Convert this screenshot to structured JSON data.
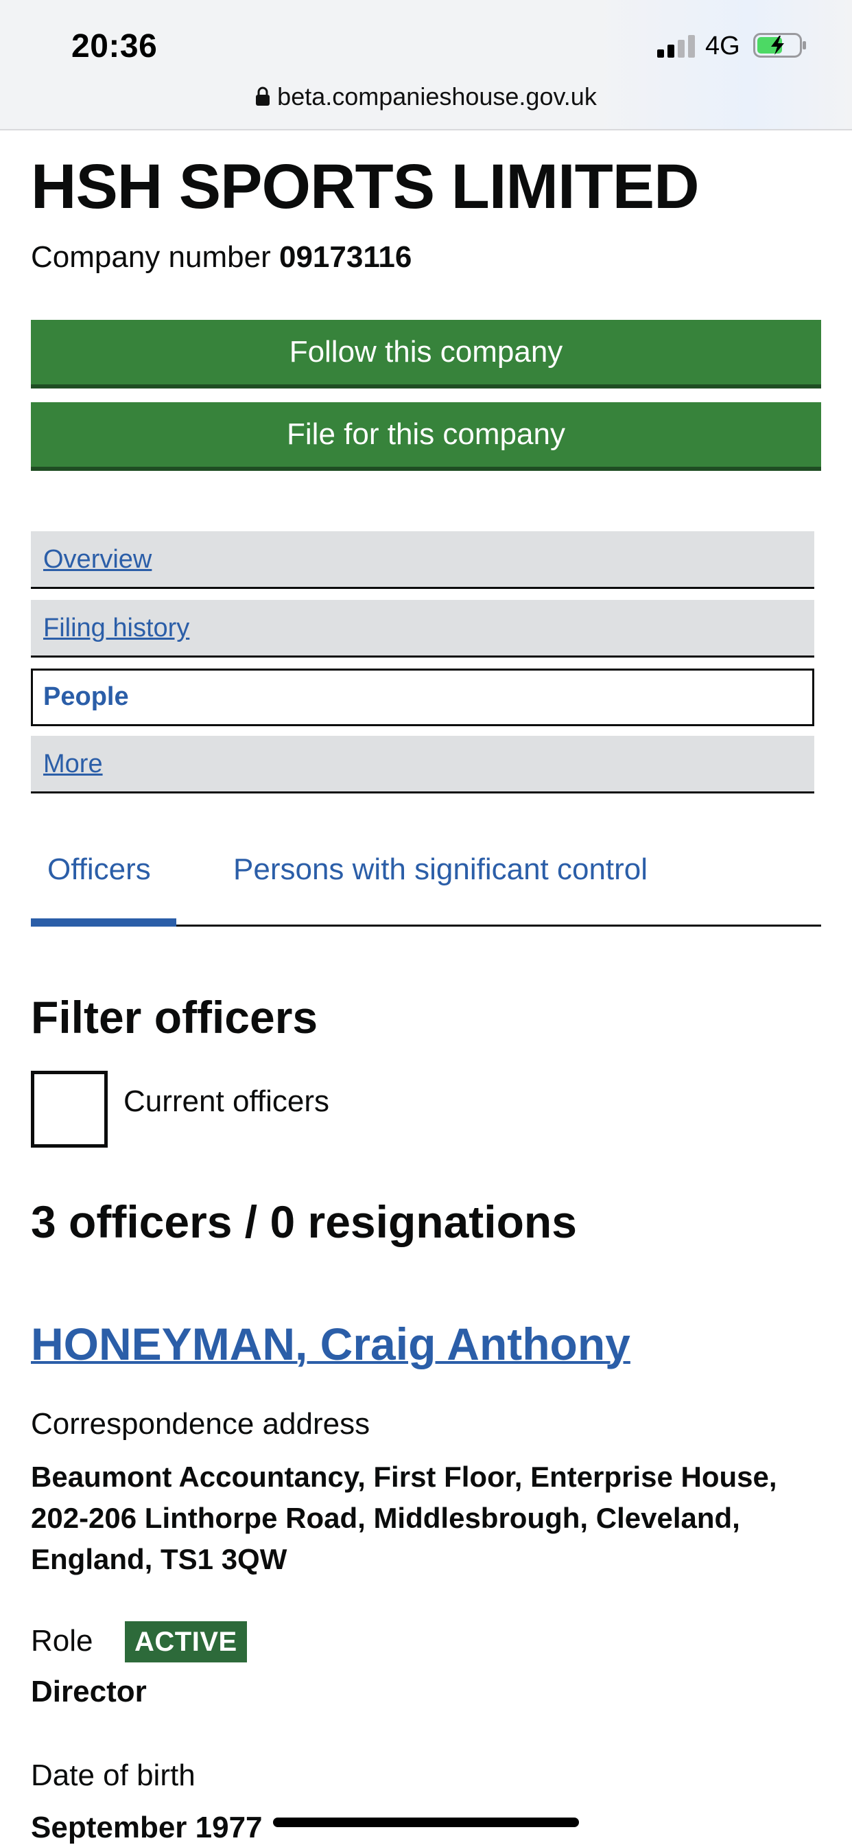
{
  "status_bar": {
    "time": "20:36",
    "network": "4G",
    "url": "beta.companieshouse.gov.uk",
    "battery_color": "#4cd964",
    "icons": [
      "signal-icon",
      "battery-charging-icon",
      "lock-icon"
    ]
  },
  "company": {
    "name": "HSH SPORTS LIMITED",
    "number_label": "Company number",
    "number": "09173116"
  },
  "actions": {
    "follow_label": "Follow this company",
    "file_label": "File for this company"
  },
  "nav": {
    "items": [
      {
        "label": "Overview",
        "active": false
      },
      {
        "label": "Filing history",
        "active": false
      },
      {
        "label": "People",
        "active": true
      },
      {
        "label": "More",
        "active": false
      }
    ]
  },
  "tabs": {
    "items": [
      {
        "label": "Officers",
        "selected": true
      },
      {
        "label": "Persons with significant control",
        "selected": false
      }
    ]
  },
  "filter": {
    "heading": "Filter officers",
    "checkbox_label": "Current officers",
    "checked": false
  },
  "summary": {
    "count_text": "3 officers / 0 resignations"
  },
  "officer": {
    "name": "HONEYMAN, Craig Anthony",
    "correspondence_label": "Correspondence address",
    "address": "Beaumont Accountancy, First Floor, Enterprise House, 202-206 Linthorpe Road, Middlesbrough, Cleveland, England, TS1 3QW",
    "role_label": "Role",
    "status": "ACTIVE",
    "role": "Director",
    "dob_label": "Date of birth",
    "dob": "September 1977"
  },
  "colors": {
    "button_green": "#37833b",
    "link_blue": "#2b5ea8",
    "nav_grey": "#dee0e2",
    "badge_green": "#2d6a3a"
  }
}
